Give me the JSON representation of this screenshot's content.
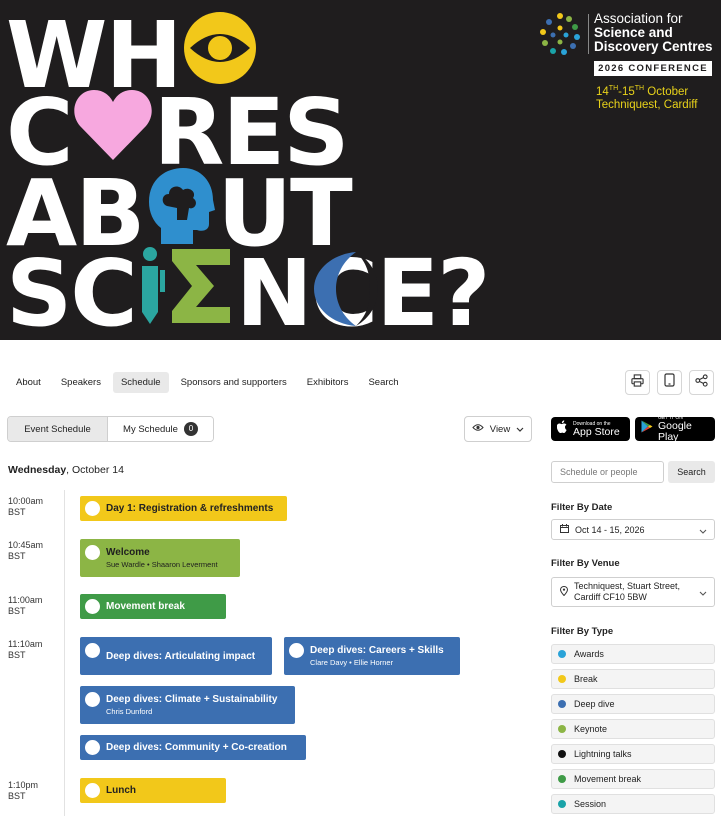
{
  "banner": {
    "line1": [
      "WH"
    ],
    "line2": [
      "C",
      "RES"
    ],
    "line3": [
      "AB",
      "UT"
    ],
    "line4": [
      "SC",
      "NCE?"
    ],
    "org_name_l1": "Association for",
    "org_name_l2": "Science and",
    "org_name_l3": "Discovery Centres",
    "conference_badge": "2026 CONFERENCE",
    "date_line1": "14TH-15TH October",
    "date_line2": "Techniquest, Cardiff",
    "icons": [
      "eye-icon",
      "heart-icon",
      "head-profile-icon",
      "i-pen-icon",
      "sigma-icon",
      "crescent-moon-icon"
    ],
    "colors": {
      "background": "#1f1d1e",
      "eye": "#f2c81a",
      "heart": "#f7a8df",
      "head": "#2f8fce",
      "pen": "#2ba6a0",
      "sigma": "#8cb545",
      "moon": "#3c6fb1"
    }
  },
  "nav": {
    "items": [
      {
        "label": "About",
        "active": false
      },
      {
        "label": "Speakers",
        "active": false
      },
      {
        "label": "Schedule",
        "active": true
      },
      {
        "label": "Sponsors and supporters",
        "active": false
      },
      {
        "label": "Exhibitors",
        "active": false
      },
      {
        "label": "Search",
        "active": false
      }
    ],
    "icons": [
      "print-icon",
      "mobile-icon",
      "share-icon"
    ]
  },
  "schedule": {
    "tab_event": "Event Schedule",
    "tab_my": "My Schedule",
    "my_count": "0",
    "view_label": "View",
    "day_weekday": "Wednesday",
    "day_date": ", October 14",
    "times": [
      {
        "t": "10:00am",
        "z": "BST"
      },
      {
        "t": "10:45am",
        "z": "BST"
      },
      {
        "t": "11:00am",
        "z": "BST"
      },
      {
        "t": "11:10am",
        "z": "BST"
      },
      {
        "t": "1:10pm",
        "z": "BST"
      }
    ],
    "sessions": [
      {
        "title": "Day 1: Registration & refreshments",
        "speakers": "",
        "color": "#f2c81a"
      },
      {
        "title": "Welcome",
        "speakers": "Sue Wardle • Shaaron Leverment",
        "color": "#8cb545"
      },
      {
        "title": "Movement break",
        "speakers": "",
        "color": "#3f9b47"
      },
      {
        "title": "Deep dives: Articulating impact",
        "speakers": "",
        "color": "#3c6fb1"
      },
      {
        "title": "Deep dives: Careers + Skills",
        "speakers": "Clare Davy • Ellie Horner",
        "color": "#3c6fb1"
      },
      {
        "title": "Deep dives: Climate + Sustainability",
        "speakers": "Chris Dunford",
        "color": "#3c6fb1"
      },
      {
        "title": "Deep dives: Community + Co-creation",
        "speakers": "",
        "color": "#3c6fb1"
      },
      {
        "title": "Lunch",
        "speakers": "",
        "color": "#f2c81a"
      }
    ]
  },
  "sidebar": {
    "appstore_small": "Download on the",
    "appstore_big": "App Store",
    "googleplay_small": "GET IT ON",
    "googleplay_big": "Google Play",
    "search_placeholder": "Schedule or people",
    "search_button": "Search",
    "filter_date_label": "Filter By Date",
    "filter_date_value": "Oct 14 - 15, 2026",
    "filter_venue_label": "Filter By Venue",
    "filter_venue_l1": "Techniquest, Stuart Street,",
    "filter_venue_l2": "Cardiff CF10 5BW",
    "filter_type_label": "Filter By Type",
    "types": [
      {
        "label": "Awards",
        "color": "#2aa3d8"
      },
      {
        "label": "Break",
        "color": "#f2c81a"
      },
      {
        "label": "Deep dive",
        "color": "#3c6fb1"
      },
      {
        "label": "Keynote",
        "color": "#8cb545"
      },
      {
        "label": "Lightning talks",
        "color": "#111111"
      },
      {
        "label": "Movement break",
        "color": "#3f9b47"
      },
      {
        "label": "Session",
        "color": "#1aa3a8"
      }
    ]
  }
}
